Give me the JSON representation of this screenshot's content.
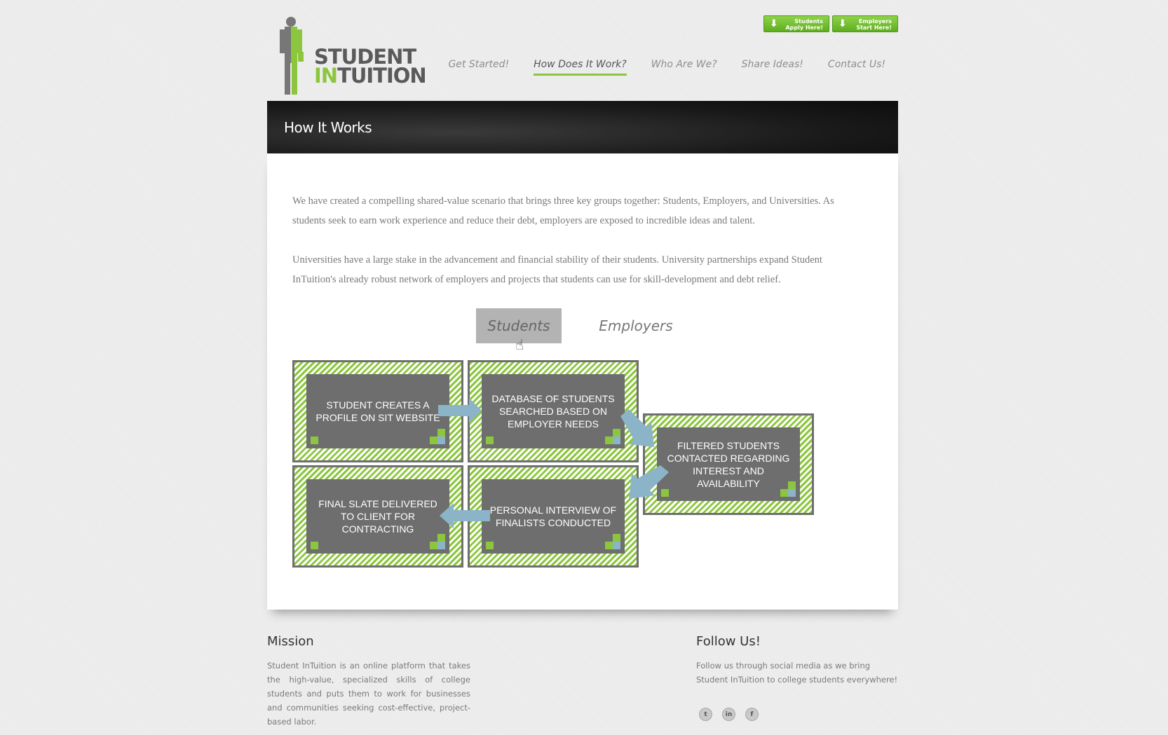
{
  "logo": {
    "line1": "STUDENT",
    "line2_prefix": "IN",
    "line2_suffix": "TUITION"
  },
  "top_buttons": [
    {
      "line1": "Students",
      "line2": "Apply Here!"
    },
    {
      "line1": "Employers",
      "line2": "Start Here!"
    }
  ],
  "nav": [
    {
      "label": "Get Started!",
      "active": false
    },
    {
      "label": "How Does It Work?",
      "active": true
    },
    {
      "label": "Who Are We?",
      "active": false
    },
    {
      "label": "Share Ideas!",
      "active": false
    },
    {
      "label": "Contact Us!",
      "active": false
    }
  ],
  "banner": {
    "title": "How It Works"
  },
  "content": {
    "p1": "We have created a compelling shared-value scenario that brings three key groups together: Students, Employers, and Universities. As students seek to earn work experience and reduce their debt, employers are exposed to incredible ideas and talent.",
    "p2": "Universities have a large stake in the advancement and financial stability of their students. University partnerships expand Student InTuition's already robust network of employers and projects that students can use for skill-development and debt relief."
  },
  "tabs": {
    "students": "Students",
    "employers": "Employers"
  },
  "flow": {
    "step1": "STUDENT CREATES A PROFILE ON SIT WEBSITE",
    "step2": "DATABASE OF STUDENTS SEARCHED BASED ON EMPLOYER NEEDS",
    "step3": "FILTERED STUDENTS CONTACTED REGARDING INTEREST AND AVAILABILITY",
    "step4": "PERSONAL INTERVIEW OF FINALISTS CONDUCTED",
    "step5": "FINAL SLATE DELIVERED TO CLIENT FOR CONTRACTING"
  },
  "footer": {
    "mission_title": "Mission",
    "mission_text": "Student InTuition is an online platform that takes the high-value, specialized skills of college students and puts them to work for businesses and communities seeking cost-effective, project-based labor.",
    "follow_title": "Follow Us!",
    "follow_text": "Follow us through social media as we bring Student InTuition to college students everywhere!",
    "social": [
      {
        "icon": "twitter-icon",
        "glyph": "t"
      },
      {
        "icon": "linkedin-icon",
        "glyph": "in"
      },
      {
        "icon": "facebook-icon",
        "glyph": "f"
      }
    ]
  },
  "colors": {
    "accent": "#8cc63f",
    "dark": "#1a1a1a",
    "arrow": "#8cb4c8"
  }
}
